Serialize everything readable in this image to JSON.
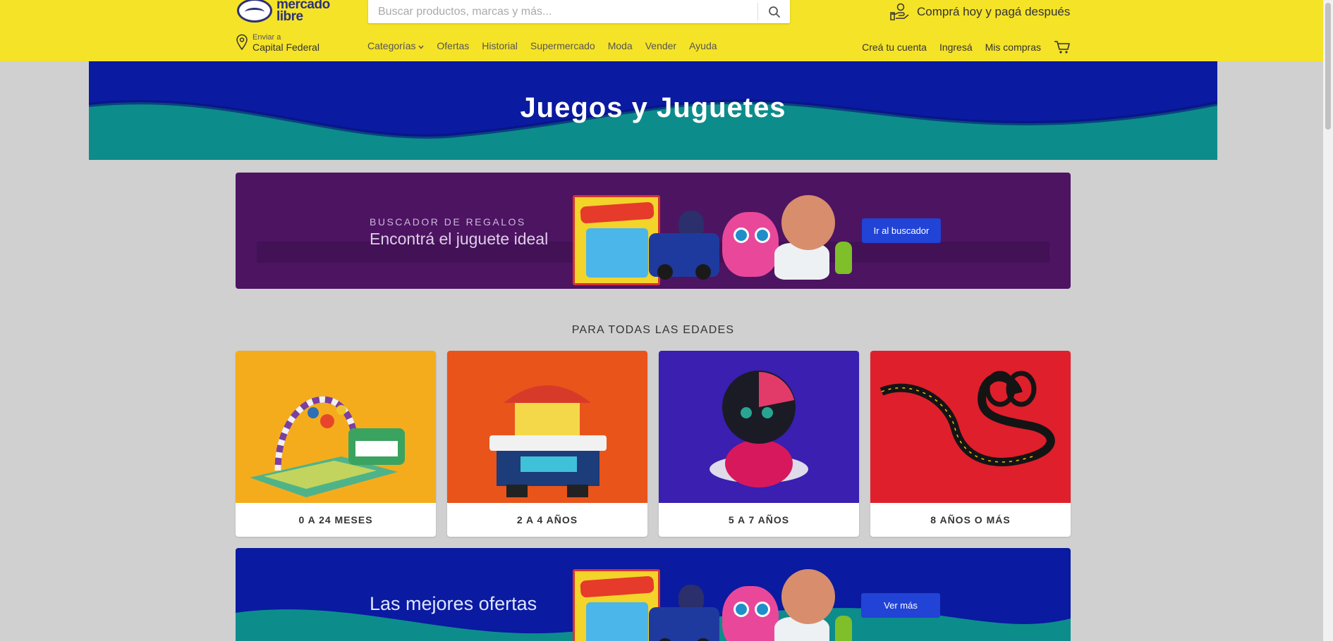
{
  "header": {
    "logo_line1": "mercado",
    "logo_line2": "libre",
    "search_placeholder": "Buscar productos, marcas y más...",
    "promo_text": "Comprá hoy y pagá después",
    "location_small": "Enviar a",
    "location_big": "Capital Federal",
    "nav": {
      "categorias": "Categorías",
      "ofertas": "Ofertas",
      "historial": "Historial",
      "supermercado": "Supermercado",
      "moda": "Moda",
      "vender": "Vender",
      "ayuda": "Ayuda"
    },
    "nav_right": {
      "crea_cuenta": "Creá tu cuenta",
      "ingresa": "Ingresá",
      "mis_compras": "Mis compras"
    }
  },
  "hero": {
    "title": "Juegos y Juguetes"
  },
  "gift_banner": {
    "eyebrow": "BUSCADOR DE REGALOS",
    "title": "Encontrá el juguete ideal",
    "button": "Ir al buscador"
  },
  "ages": {
    "title": "PARA TODAS LAS EDADES",
    "cards": [
      {
        "label": "0 A 24 MESES"
      },
      {
        "label": "2 A 4 AÑOS"
      },
      {
        "label": "5 A 7 AÑOS"
      },
      {
        "label": "8 AÑOS O MÁS"
      }
    ]
  },
  "offers_banner": {
    "title": "Las mejores ofertas",
    "button": "Ver más"
  },
  "colors": {
    "header_bg": "#f5e328",
    "hero_blue": "#0a1aa1",
    "hero_teal": "#0d8c8c",
    "gift_purple": "#4d1462",
    "button_blue": "#2143d6"
  }
}
